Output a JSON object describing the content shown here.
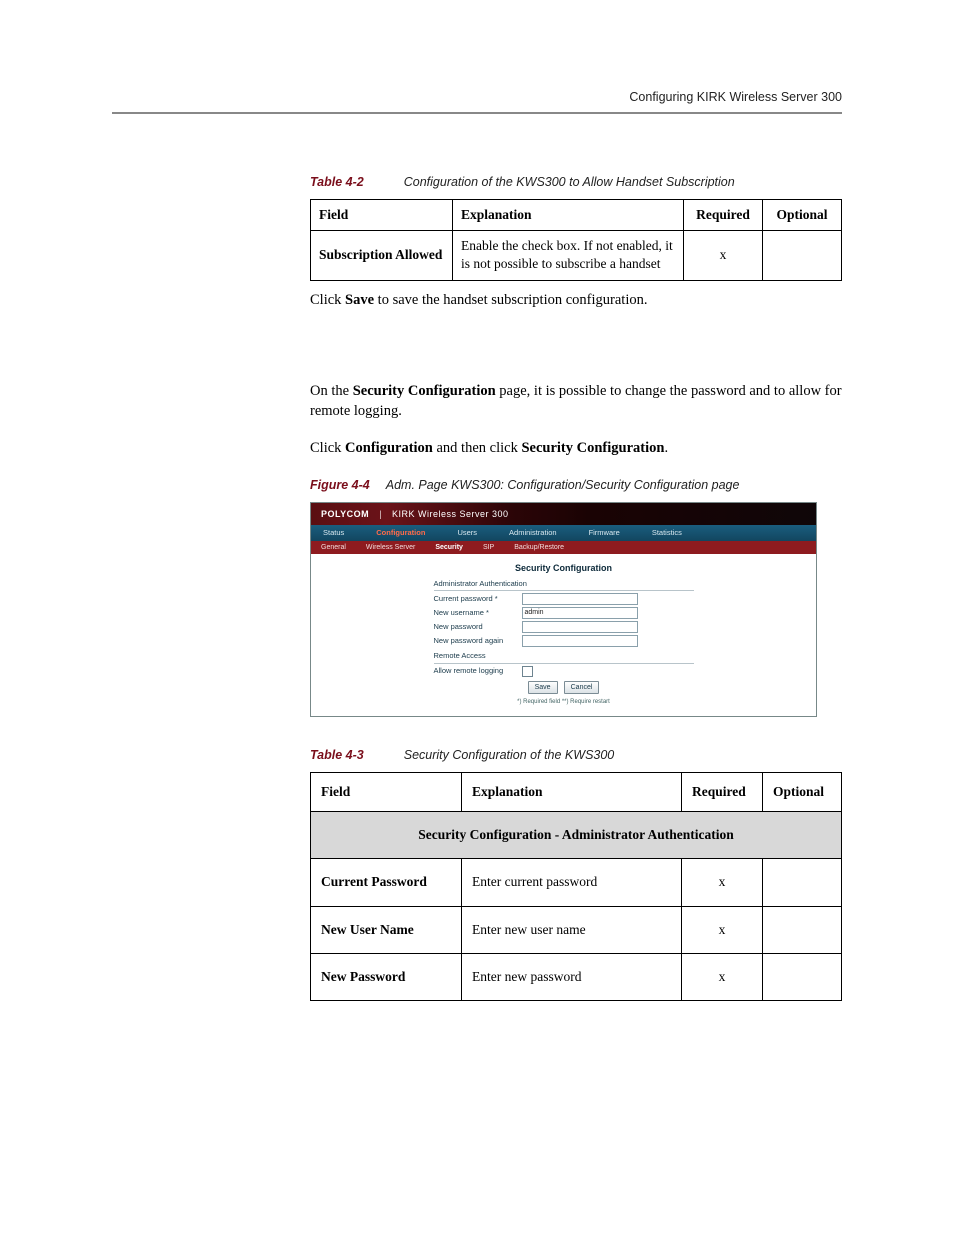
{
  "header": {
    "running_head": "Configuring KIRK Wireless Server 300"
  },
  "captions": {
    "t42_label": "Table 4-2",
    "t42_text": "Configuration of the KWS300 to Allow Handset Subscription",
    "fig44_label": "Figure 4-4",
    "fig44_text": "Adm. Page KWS300: Configuration/Security Configuration page",
    "t43_label": "Table 4-3",
    "t43_text": "Security Configuration of the KWS300"
  },
  "table42": {
    "cols": {
      "field": "Field",
      "explanation": "Explanation",
      "required": "Required",
      "optional": "Optional"
    },
    "rows": [
      {
        "field": "Subscription Allowed",
        "explanation": "Enable the check box. If not enabled, it is not possible to subscribe a handset",
        "required": "x",
        "optional": ""
      }
    ]
  },
  "paragraphs": {
    "p1_pre": "Click ",
    "p1_b": "Save",
    "p1_post": " to save the handset subscription configuration.",
    "p2_pre": "On the ",
    "p2_b": "Security Configuration",
    "p2_post": " page, it is possible to change the password and to allow for remote logging.",
    "p3_a": "Click ",
    "p3_b1": "Configuration",
    "p3_mid": " and then click ",
    "p3_b2": "Security Configuration",
    "p3_end": "."
  },
  "figure": {
    "brand": "POLYCOM",
    "product": "KIRK Wireless Server 300",
    "top_tabs": [
      "Status",
      "Configuration",
      "Users",
      "Administration",
      "Firmware",
      "Statistics"
    ],
    "top_active_index": 1,
    "sub_tabs": [
      "General",
      "Wireless Server",
      "Security",
      "SIP",
      "Backup/Restore"
    ],
    "sub_active_index": 2,
    "panel_title": "Security Configuration",
    "section1": "Administrator Authentication",
    "rows": {
      "current_password": "Current password *",
      "new_username": "New username *",
      "new_username_value": "admin",
      "new_password": "New password",
      "new_password_again": "New password again"
    },
    "section2": "Remote Access",
    "allow_remote": "Allow remote logging",
    "buttons": {
      "save": "Save",
      "cancel": "Cancel"
    },
    "footnote": "*) Required field  **) Require restart"
  },
  "table43": {
    "cols": {
      "field": "Field",
      "explanation": "Explanation",
      "required": "Required",
      "optional": "Optional"
    },
    "section": "Security Configuration - Administrator Authentication",
    "rows": [
      {
        "field": "Current Password",
        "explanation": "Enter current password",
        "required": "x",
        "optional": ""
      },
      {
        "field": "New User Name",
        "explanation": "Enter new user name",
        "required": "x",
        "optional": ""
      },
      {
        "field": "New Password",
        "explanation": "Enter new password",
        "required": "x",
        "optional": ""
      }
    ]
  }
}
